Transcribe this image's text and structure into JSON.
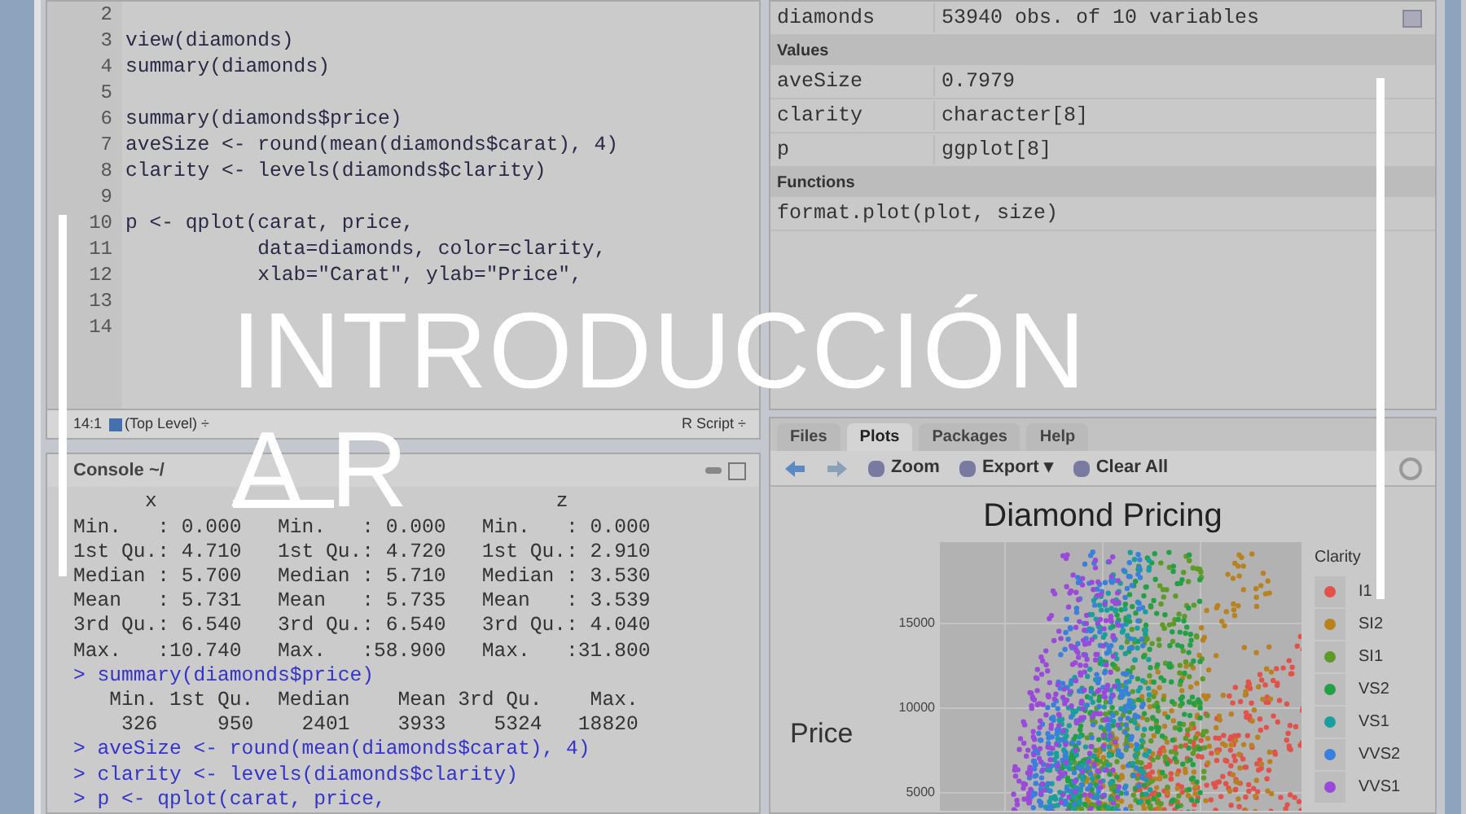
{
  "editor": {
    "lines": [
      {
        "number": "2"
      },
      {
        "number": "3",
        "code": "view(diamonds)"
      },
      {
        "number": "4",
        "code": "summary(diamonds)"
      },
      {
        "number": "5"
      },
      {
        "number": "6",
        "code": "summary(diamonds$price)"
      },
      {
        "number": "7",
        "code": "aveSize <- round(mean(diamonds$carat), 4)"
      },
      {
        "number": "8",
        "code": "clarity <- levels(diamonds$clarity)"
      },
      {
        "number": "9"
      },
      {
        "number": "10",
        "code": "p <- qplot(carat, price,"
      },
      {
        "number": "11",
        "code": "           data=diamonds, color=clarity,"
      },
      {
        "number": "12",
        "code": "           xlab=\"Carat\", ylab=\"Price\","
      },
      {
        "number": "13"
      },
      {
        "number": "14"
      }
    ],
    "status": {
      "position": "14:1",
      "scope": "(Top Level) ÷",
      "file_type": "R Script ÷"
    }
  },
  "console": {
    "title": "Console ~/",
    "columns": [
      "x",
      "z"
    ],
    "lines": [
      {
        "kind": "output",
        "text": "Min.   : 0.000   Min.   : 0.000   Min.   : 0.000"
      },
      {
        "kind": "output",
        "text": "1st Qu.: 4.710   1st Qu.: 4.720   1st Qu.: 2.910"
      },
      {
        "kind": "output",
        "text": "Median : 5.700   Median : 5.710   Median : 3.530"
      },
      {
        "kind": "output",
        "text": "Mean   : 5.731   Mean   : 5.735   Mean   : 3.539"
      },
      {
        "kind": "output",
        "text": "3rd Qu.: 6.540   3rd Qu.: 6.540   3rd Qu.: 4.040"
      },
      {
        "kind": "output",
        "text": "Max.   :10.740   Max.   :58.900   Max.   :31.800"
      },
      {
        "kind": "command",
        "text": "> summary(diamonds$price)"
      },
      {
        "kind": "output",
        "text": "   Min. 1st Qu.  Median    Mean 3rd Qu.    Max."
      },
      {
        "kind": "output",
        "text": "    326     950    2401    3933    5324   18820"
      },
      {
        "kind": "command",
        "text": "> aveSize <- round(mean(diamonds$carat), 4)"
      },
      {
        "kind": "command",
        "text": "> clarity <- levels(diamonds$clarity)"
      },
      {
        "kind": "command",
        "text": "> p <- qplot(carat, price,"
      }
    ]
  },
  "environment": {
    "rows": [
      {
        "kind": "row",
        "name": "diamonds",
        "value": "53940 obs. of 10 variables"
      },
      {
        "kind": "section",
        "name": "Values"
      },
      {
        "kind": "row",
        "name": "aveSize",
        "value": "0.7979"
      },
      {
        "kind": "row",
        "name": "clarity",
        "value": "character[8]"
      },
      {
        "kind": "row",
        "name": "p",
        "value": "ggplot[8]"
      },
      {
        "kind": "section",
        "name": "Functions"
      },
      {
        "kind": "row",
        "name": "format.plot(plot, size)"
      }
    ]
  },
  "plots_pane": {
    "tabs": [
      {
        "label": "Files",
        "selected": false
      },
      {
        "label": "Plots",
        "selected": true
      },
      {
        "label": "Packages",
        "selected": false
      },
      {
        "label": "Help",
        "selected": false
      }
    ],
    "toolbar": [
      "Zoom",
      "Export ▾",
      "Clear All"
    ],
    "plot": {
      "title": "Diamond Pricing",
      "ylabel": "Price",
      "yticks": [
        "15000",
        "10000",
        "5000"
      ],
      "legend_title": "Clarity",
      "legend": [
        {
          "label": "I1",
          "color": "#e0524a"
        },
        {
          "label": "SI2",
          "color": "#b88220"
        },
        {
          "label": "SI1",
          "color": "#5e9a28"
        },
        {
          "label": "VS2",
          "color": "#23a047"
        },
        {
          "label": "VS1",
          "color": "#1a9e9e"
        },
        {
          "label": "VVS2",
          "color": "#3a7fdc"
        },
        {
          "label": "VVS1",
          "color": "#9a4ad8"
        }
      ]
    }
  },
  "overlay": {
    "title_lines": [
      "INTRODUCCIÓN",
      "A R"
    ]
  }
}
